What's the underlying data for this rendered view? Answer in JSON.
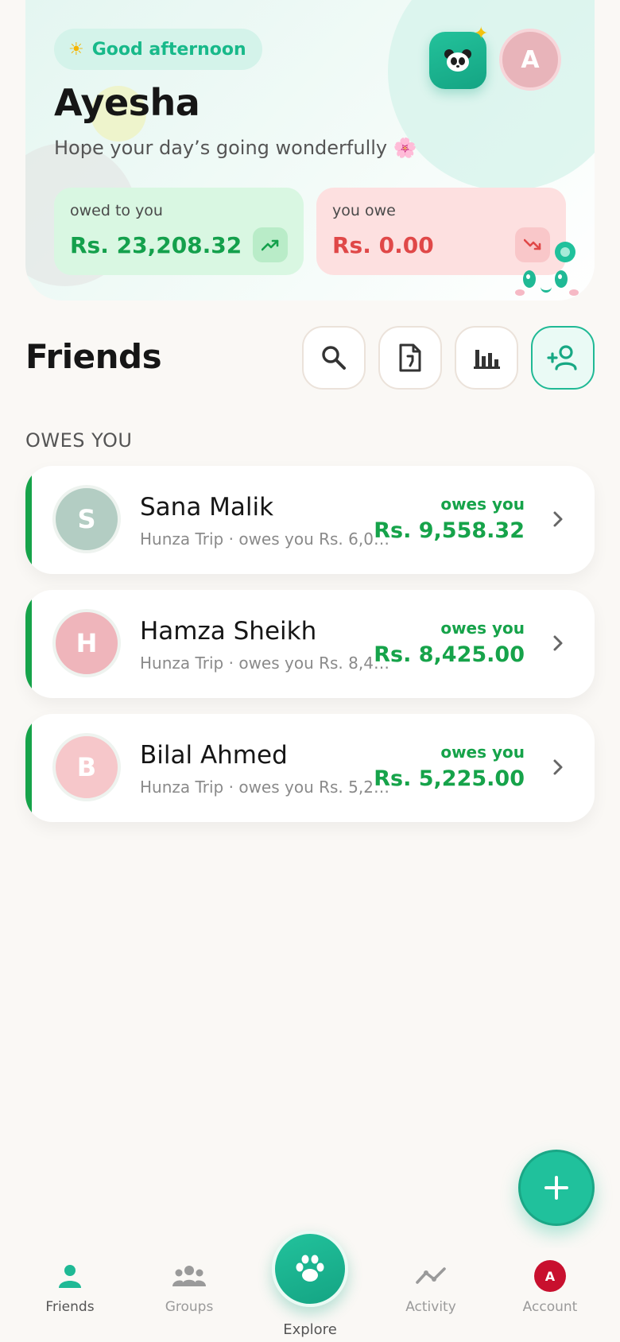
{
  "header": {
    "greeting": "Good afternoon",
    "greeting_icon": "sun-icon",
    "user_name": "Ayesha",
    "subtitle": "Hope your day’s going wonderfully",
    "subtitle_emoji": "🌸",
    "avatar_initial": "A"
  },
  "balances": {
    "owed_to_you_label": "owed to you",
    "owed_to_you_value": "Rs. 23,208.32",
    "you_owe_label": "you owe",
    "you_owe_value": "Rs. 0.00"
  },
  "friends_section": {
    "title": "Friends",
    "group_heading": "OWES YOU",
    "toolbar_icons": [
      "search-icon",
      "document-icon",
      "bar-chart-icon",
      "add-person-icon"
    ]
  },
  "friends": [
    {
      "initial": "S",
      "name": "Sana Malik",
      "detail": "Hunza Trip · owes you Rs. 6,02...",
      "status": "owes you",
      "amount": "Rs. 9,558.32",
      "avatar_color": "#b3cdc3"
    },
    {
      "initial": "H",
      "name": "Hamza Sheikh",
      "detail": "Hunza Trip · owes you Rs. 8,42...",
      "status": "owes you",
      "amount": "Rs. 8,425.00",
      "avatar_color": "#efb5bb"
    },
    {
      "initial": "B",
      "name": "Bilal Ahmed",
      "detail": "Hunza Trip · owes you Rs. 5,22...",
      "status": "owes you",
      "amount": "Rs. 5,225.00",
      "avatar_color": "#f6c7ca"
    }
  ],
  "nav": {
    "friends": "Friends",
    "groups": "Groups",
    "explore": "Explore",
    "activity": "Activity",
    "account": "Account",
    "account_initial": "A"
  },
  "colors": {
    "accent": "#20c19c",
    "positive": "#16a34a",
    "negative": "#e04848"
  }
}
